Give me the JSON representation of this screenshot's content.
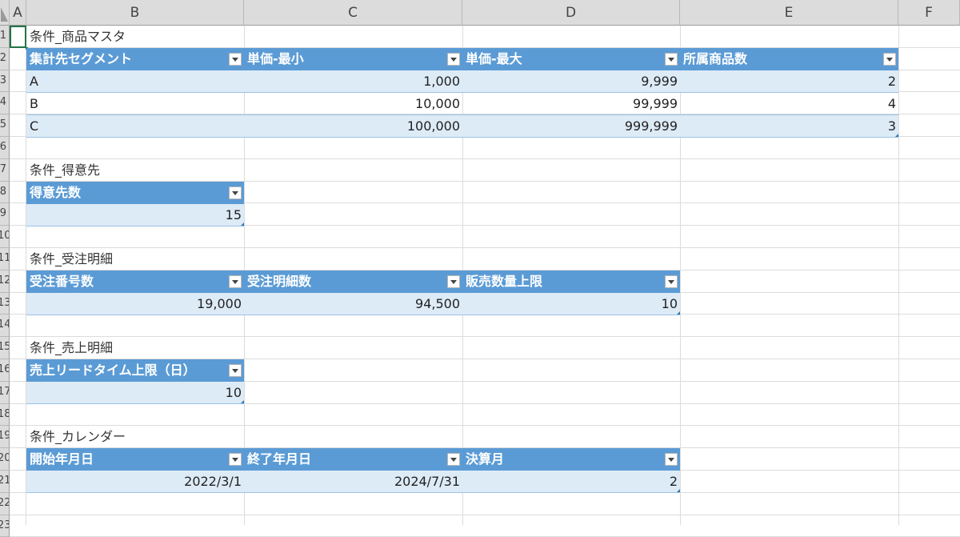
{
  "columns": [
    "A",
    "B",
    "C",
    "D",
    "E",
    "F"
  ],
  "row_numbers": [
    "1",
    "2",
    "3",
    "4",
    "5",
    "6",
    "7",
    "8",
    "9",
    "10",
    "11",
    "12",
    "13",
    "14",
    "15",
    "16",
    "17",
    "18",
    "19",
    "20",
    "21",
    "22",
    "23"
  ],
  "tables": {
    "product": {
      "title": "条件_商品マスタ",
      "headers": [
        "集計先セグメント",
        "単価-最小",
        "単価-最大",
        "所属商品数"
      ],
      "rows": [
        [
          "A",
          "1,000",
          "9,999",
          "2"
        ],
        [
          "B",
          "10,000",
          "99,999",
          "4"
        ],
        [
          "C",
          "100,000",
          "999,999",
          "3"
        ]
      ]
    },
    "customer": {
      "title": "条件_得意先",
      "headers": [
        "得意先数"
      ],
      "rows": [
        [
          "15"
        ]
      ]
    },
    "order": {
      "title": "条件_受注明細",
      "headers": [
        "受注番号数",
        "受注明細数",
        "販売数量上限"
      ],
      "rows": [
        [
          "19,000",
          "94,500",
          "10"
        ]
      ]
    },
    "sales": {
      "title": "条件_売上明細",
      "headers": [
        "売上リードタイム上限（日）"
      ],
      "rows": [
        [
          "10"
        ]
      ]
    },
    "calendar": {
      "title": "条件_カレンダー",
      "headers": [
        "開始年月日",
        "終了年月日",
        "決算月"
      ],
      "rows": [
        [
          "2022/3/1",
          "2024/7/31",
          "2"
        ]
      ]
    }
  },
  "colors": {
    "header_fill": "#5b9bd5",
    "band_fill": "#ddebf7",
    "selection": "#217346"
  },
  "icons": {
    "filter": "filter-dropdown-icon"
  }
}
